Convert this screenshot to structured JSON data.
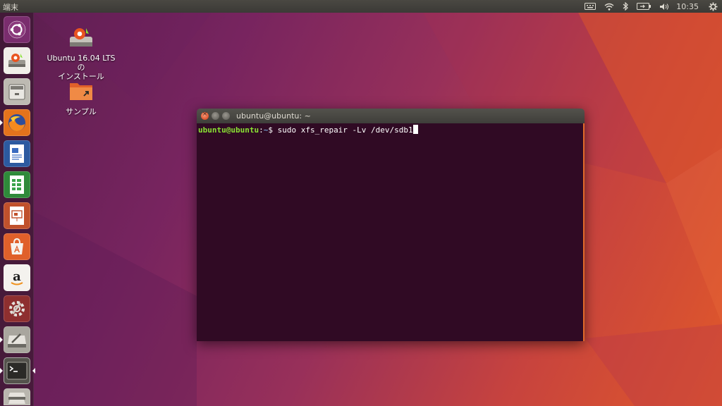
{
  "panel": {
    "app_title": "端末",
    "clock": "10:35",
    "indicators": [
      "keyboard-icon",
      "wifi-icon",
      "bluetooth-icon",
      "battery-icon",
      "volume-icon",
      "gear-icon"
    ]
  },
  "launcher": {
    "items": [
      {
        "name": "ubuntu-dash-button",
        "icon": "ubuntu-logo-icon",
        "running": false
      },
      {
        "name": "launcher-installer",
        "icon": "installer-icon",
        "running": false
      },
      {
        "name": "launcher-files",
        "icon": "file-cabinet-icon",
        "running": false
      },
      {
        "name": "launcher-firefox",
        "icon": "firefox-icon",
        "running": true
      },
      {
        "name": "launcher-writer",
        "icon": "writer-doc-icon",
        "running": false
      },
      {
        "name": "launcher-calc",
        "icon": "calc-sheet-icon",
        "running": false
      },
      {
        "name": "launcher-impress",
        "icon": "impress-slides-icon",
        "running": false
      },
      {
        "name": "launcher-software",
        "icon": "software-center-icon",
        "running": false
      },
      {
        "name": "launcher-amazon",
        "icon": "amazon-icon",
        "running": false
      },
      {
        "name": "launcher-settings",
        "icon": "settings-wrench-icon",
        "running": false
      },
      {
        "name": "launcher-drive",
        "icon": "disk-drive-icon",
        "running": true
      },
      {
        "name": "launcher-terminal",
        "icon": "terminal-icon",
        "running": true,
        "focused": true
      },
      {
        "name": "launcher-trash",
        "icon": "disk-stack-icon",
        "running": false
      }
    ]
  },
  "desktop": {
    "icons": [
      {
        "label_line1": "Ubuntu 16.04 LTS の",
        "label_line2": "インストール",
        "icon": "installer-icon"
      },
      {
        "label_line1": "サンプル",
        "label_line2": "",
        "icon": "folder-icon"
      }
    ]
  },
  "terminal": {
    "title": "ubuntu@ubuntu: ~",
    "prompt_user": "ubuntu@ubuntu",
    "prompt_sep": ":",
    "prompt_path": "~",
    "prompt_symbol": "$ ",
    "command": "sudo xfs_repair -Lv /dev/sdb1"
  },
  "colors": {
    "terminal_bg": "#300a24",
    "prompt_user": "#8ae234",
    "prompt_path": "#729fcf",
    "accent_orange": "#e16a2a",
    "close_button": "#e0532c"
  }
}
